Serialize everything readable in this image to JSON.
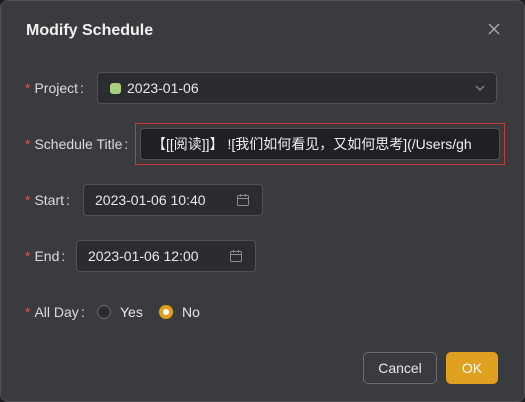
{
  "dialog": {
    "title": "Modify Schedule",
    "close_icon": "close-icon"
  },
  "form": {
    "required_mark": "*",
    "project": {
      "label": "Project",
      "value": "2023-01-06",
      "color": "#a8d080"
    },
    "schedule_title": {
      "label": "Schedule Title",
      "value": "【[[阅读]]】 ![我们如何看见，又如何思考](/Users/gh"
    },
    "start": {
      "label": "Start",
      "value": "2023-01-06 10:40"
    },
    "end": {
      "label": "End",
      "value": "2023-01-06 12:00"
    },
    "all_day": {
      "label": "All Day",
      "options": [
        "Yes",
        "No"
      ],
      "selected": "No"
    }
  },
  "buttons": {
    "cancel": "Cancel",
    "ok": "OK"
  },
  "colors": {
    "accent": "#dfa11f",
    "required": "#e2504c",
    "error_border": "#c43838"
  }
}
